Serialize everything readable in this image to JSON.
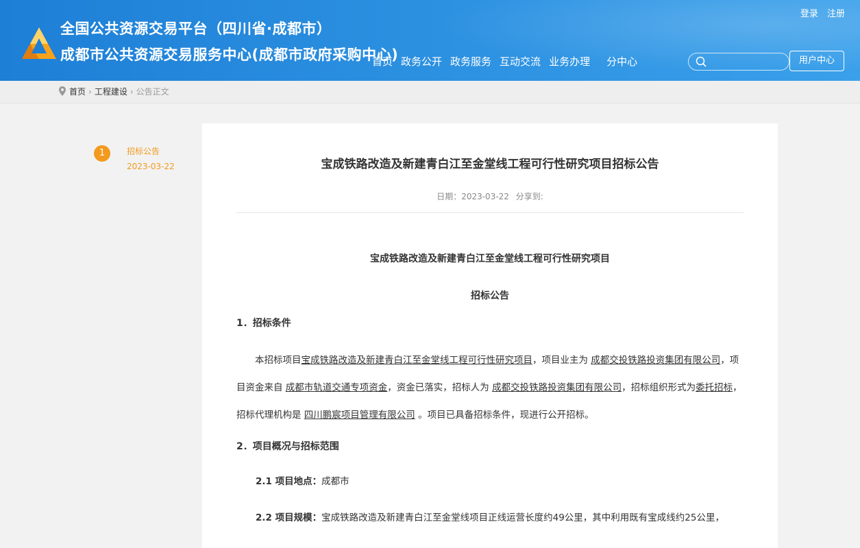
{
  "header": {
    "title_line1": "全国公共资源交易平台（四川省·成都市）",
    "title_line2": "成都市公共资源交易服务中心(成都市政府采购中心)",
    "login": "登录",
    "register": "注册",
    "nav": [
      "首页",
      "政务公开",
      "政务服务",
      "互动交流",
      "业务办理",
      "分中心"
    ],
    "search_placeholder": "",
    "user_center": "用户中心"
  },
  "breadcrumb": {
    "home": "首页",
    "category": "工程建设",
    "current": "公告正文",
    "separator": "›"
  },
  "timeline": {
    "step": "1",
    "label": "招标公告",
    "date": "2023-03-22"
  },
  "article": {
    "title": "宝成铁路改造及新建青白江至金堂线工程可行性研究项目招标公告",
    "date_label": "日期：2023-03-22",
    "share_label": "分享到:",
    "subtitle1": "宝成铁路改造及新建青白江至金堂线工程可行性研究项目",
    "subtitle2": "招标公告",
    "section1_heading": "1．招标条件",
    "section1": {
      "t1": "本招标项目",
      "project": "宝成铁路改造及新建青白江至金堂线工程可行性研究项目",
      "t2": "，项目业主为 ",
      "owner": "成都交投铁路投资集团有限公司",
      "t3": "，项目资金来自 ",
      "fund": "成都市轨道交通专项资金",
      "t4": "，资金已落实，招标人为 ",
      "tenderer": "成都交投铁路投资集团有限公司",
      "t5": "，招标组织形式为",
      "form": "委托招标",
      "t6": "，招标代理机构是 ",
      "agency": "四川鹏宸项目管理有限公司",
      "t7": " 。项目已具备招标条件，现进行公开招标。"
    },
    "section2_heading": "2．项目概况与招标范围",
    "s21_label": "2.1 项目地点：",
    "s21_value": "成都市",
    "s22_label": "2.2 项目规模：",
    "s22_value": "宝成铁路改造及新建青白江至金堂线项目正线运营长度约49公里，其中利用既有宝成线约25公里，"
  },
  "colors": {
    "header_blue": "#2b8fe0",
    "accent_orange": "#f39a1e"
  }
}
